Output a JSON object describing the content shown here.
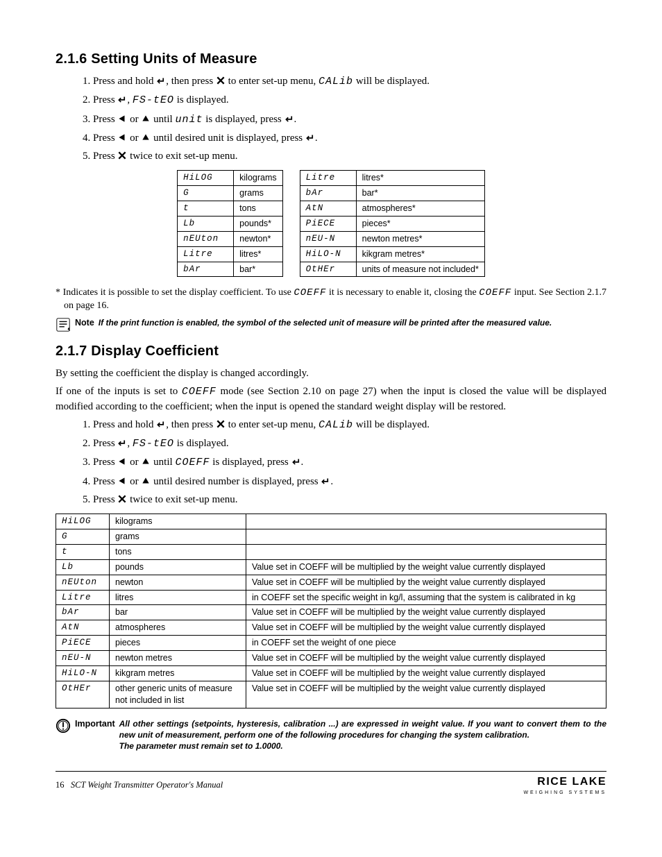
{
  "section216": {
    "num": "2.1.6",
    "title": "Setting Units of Measure",
    "steps_a": "Press and hold ",
    "steps_b": ", then press ",
    "steps_c": " to enter set-up menu, ",
    "step1_code": "CALib",
    "steps_d": " will be displayed.",
    "step2_a": "Press ",
    "step2_b": ", ",
    "step2_code": "FS-tEO",
    "step2_c": " is displayed.",
    "step3_a": "Press ",
    "step3_b": " or ",
    "step3_c": " until ",
    "step3_code": "unit",
    "step3_d": " is displayed, press ",
    "step3_e": ".",
    "step4_a": "Press ",
    "step4_b": " or ",
    "step4_c": " until desired unit is displayed, press ",
    "step4_d": ".",
    "step5_a": "Press ",
    "step5_b": " twice to exit set-up menu."
  },
  "unitsLeft": [
    {
      "code": "HiLOG",
      "label": "kilograms"
    },
    {
      "code": "G",
      "label": "grams"
    },
    {
      "code": "t",
      "label": "tons"
    },
    {
      "code": "Lb",
      "label": "pounds*"
    },
    {
      "code": "nEUton",
      "label": "newton*"
    },
    {
      "code": "Litre",
      "label": "litres*"
    },
    {
      "code": "bAr",
      "label": "bar*"
    }
  ],
  "unitsRight": [
    {
      "code": "Litre",
      "label": "litres*"
    },
    {
      "code": "bAr",
      "label": "bar*"
    },
    {
      "code": "AtN",
      "label": "atmospheres*"
    },
    {
      "code": "PiECE",
      "label": "pieces*"
    },
    {
      "code": "nEU-N",
      "label": "newton metres*"
    },
    {
      "code": "HiLO-N",
      "label": "kikgram metres*"
    },
    {
      "code": "OtHEr",
      "label": "units of measure not included*"
    }
  ],
  "footnote216_a": "* Indicates it is possible to set the display coefficient. To use ",
  "footnote216_code1": "COEFF",
  "footnote216_b": " it is necessary to enable it, closing the ",
  "footnote216_code2": "COEFF",
  "footnote216_c": " input. See Section 2.1.7 on page 16.",
  "note216": "If the print function is enabled, the symbol of the selected unit of measure will be printed after the measured value.",
  "noteLabel": "Note",
  "section217": {
    "num": "2.1.7",
    "title": "Display Coefficient",
    "intro": "By setting the coefficient the display is changed accordingly.",
    "para_a": "If one of the inputs is set to ",
    "para_code": "COEFF",
    "para_b": " mode (see Section 2.10 on page 27) when the input is closed the value will be displayed modified according to the coefficient; when the input is opened the standard weight display will be restored.",
    "step3_code": "COEFF",
    "step4_text": " until desired number is displayed, press "
  },
  "coeffTable": [
    {
      "code": "HiLOG",
      "unit": "kilograms",
      "desc": ""
    },
    {
      "code": "G",
      "unit": "grams",
      "desc": ""
    },
    {
      "code": "t",
      "unit": "tons",
      "desc": ""
    },
    {
      "code": "Lb",
      "unit": "pounds",
      "desc": "Value set in COEFF will be multiplied by the weight value currently displayed"
    },
    {
      "code": "nEUton",
      "unit": "newton",
      "desc": "Value set in COEFF will be multiplied by the weight value currently displayed"
    },
    {
      "code": "Litre",
      "unit": "litres",
      "desc": "in COEFF set the specific weight in kg/l, assuming that the system is calibrated in kg"
    },
    {
      "code": "bAr",
      "unit": "bar",
      "desc": "Value set in COEFF will be multiplied by the weight value currently displayed"
    },
    {
      "code": "AtN",
      "unit": "atmospheres",
      "desc": "Value set in COEFF will be multiplied by the weight value currently displayed"
    },
    {
      "code": "PiECE",
      "unit": "pieces",
      "desc": "in COEFF set the weight of one piece"
    },
    {
      "code": "nEU-N",
      "unit": "newton metres",
      "desc": "Value set in COEFF will be multiplied by the weight value currently displayed"
    },
    {
      "code": "HiLO-N",
      "unit": "kikgram metres",
      "desc": "Value set in COEFF will be multiplied by the weight value currently displayed"
    },
    {
      "code": "OtHEr",
      "unit": "other generic units of measure not included in list",
      "desc": "Value set in COEFF will be multiplied by the weight value currently displayed"
    }
  ],
  "important": {
    "label": "Important",
    "text1": "All other settings (setpoints, hysteresis, calibration ...) are expressed in weight value. If you want to convert them to the new unit of measurement, perform one of the following procedures for changing the system calibration.",
    "text2": "The parameter must remain set to 1.0000."
  },
  "footer": {
    "page": "16",
    "doc": "SCT Weight Transmitter  Operator's Manual",
    "brand": "RICE LAKE",
    "brandSub": "WEIGHING SYSTEMS"
  }
}
